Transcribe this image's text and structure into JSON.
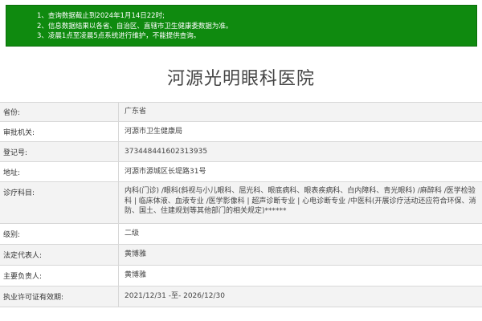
{
  "notice": {
    "lines": [
      "1、查询数据截止到2024年1月14日22时;",
      "2、信息数据结果以各省、自治区、直辖市卫生健康委数据为准。",
      "3、凌晨1点至凌晨5点系统进行维护，不能提供查询。"
    ]
  },
  "hospital": {
    "name": "河源光明眼科医院"
  },
  "fields": [
    {
      "label": "省份:",
      "value": "广东省"
    },
    {
      "label": "审批机关:",
      "value": "河源市卫生健康局"
    },
    {
      "label": "登记号:",
      "value": "373448441602313935"
    },
    {
      "label": "地址:",
      "value": "河源市源城区长堤路31号"
    },
    {
      "label": "诊疗科目:",
      "value": "内科(门诊) /眼科(斜视与小儿眼科、屈光科、眼底病科、眼表疾病科、白内障科、青光眼科) /麻醉科 /医学检验科 | 临床体液、血液专业 /医学影像科 | 超声诊断专业 | 心电诊断专业 /中医科(开展诊疗活动还应符合环保、消防、国土、住建规划等其他部门的相关规定)******"
    },
    {
      "label": "级别:",
      "value": "二级"
    },
    {
      "label": "法定代表人:",
      "value": "黄博雅"
    },
    {
      "label": "主要负责人:",
      "value": "黄博雅"
    },
    {
      "label": "执业许可证有效期:",
      "value": "2021/12/31 -至- 2026/12/30"
    }
  ]
}
